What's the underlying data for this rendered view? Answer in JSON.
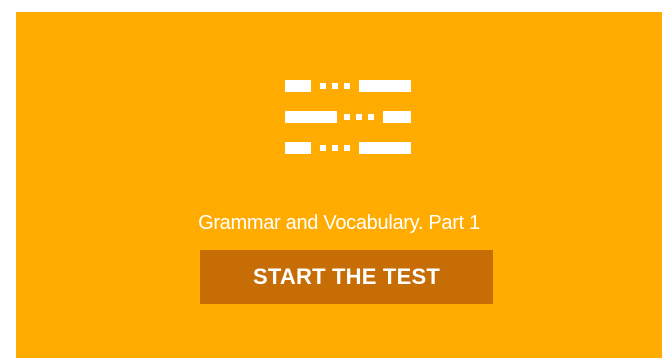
{
  "card": {
    "background_color": "#ffab00",
    "icon": "list-icon",
    "title": "Grammar and Vocabulary. Part 1",
    "button_label": "START THE TEST",
    "button_color": "#c66d05"
  }
}
